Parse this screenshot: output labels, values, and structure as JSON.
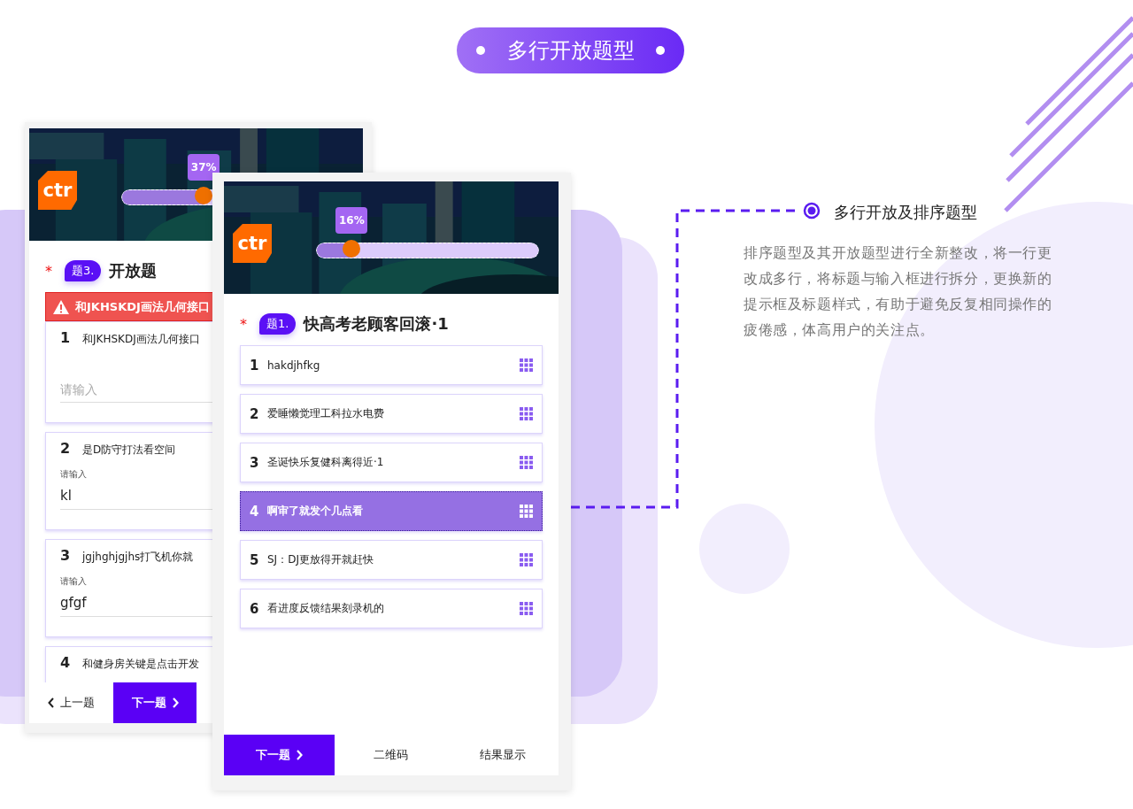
{
  "header": {
    "title": "多行开放题型"
  },
  "screens": [
    {
      "kind": "open",
      "logo": "ctr",
      "progress": {
        "label": "37%",
        "level": 0.37
      },
      "question": {
        "required_mark": "*",
        "number": "题3.",
        "title": "开放题"
      },
      "alert": "和JKHSKDJ画法几何接口",
      "items": [
        {
          "number": "1",
          "label": "和JKHSKDJ画法几何接口",
          "placeholder": "请输入"
        },
        {
          "number": "2",
          "label": "是D防守打法看空间",
          "field_label": "请输入",
          "value": "kl"
        },
        {
          "number": "3",
          "label": "jgjhghjgjhs打飞机你就",
          "field_label": "请输入",
          "value": "gfgf"
        },
        {
          "number": "4",
          "label": "和健身房关键是点击开发"
        }
      ],
      "buttons": [
        {
          "label": "上一题",
          "kind": "prev"
        },
        {
          "label": "下一题",
          "kind": "next"
        }
      ]
    },
    {
      "kind": "sort",
      "logo": "ctr",
      "progress": {
        "label": "16%",
        "level": 0.16
      },
      "question": {
        "required_mark": "*",
        "number": "题1.",
        "title": "快高考老顾客回滚·1"
      },
      "items": [
        {
          "number": "1",
          "label": "hakdjhfkg",
          "selected": false
        },
        {
          "number": "2",
          "label": "爱睡懒觉理工科拉水电费",
          "selected": false
        },
        {
          "number": "3",
          "label": "圣诞快乐复健科离得近·1",
          "selected": false
        },
        {
          "number": "4",
          "label": "啊审了就发个几点看",
          "selected": true
        },
        {
          "number": "5",
          "label": "SJ：DJ更放得开就赶快",
          "selected": false
        },
        {
          "number": "6",
          "label": "看进度反馈结果刻录机的",
          "selected": false
        }
      ],
      "buttons": [
        {
          "label": "下一题",
          "kind": "next"
        },
        {
          "label": "二维码",
          "kind": "plain"
        },
        {
          "label": "结果显示",
          "kind": "plain"
        }
      ]
    }
  ],
  "feature": {
    "title": "多行开放及排序题型",
    "description": "排序题型及其开放题型进行全新整改，将一行更改成多行，将标题与输入框进行拆分，更换新的提示框及标题样式，有助于避免反复相同操作的疲倦感，体高用户的关注点。"
  }
}
